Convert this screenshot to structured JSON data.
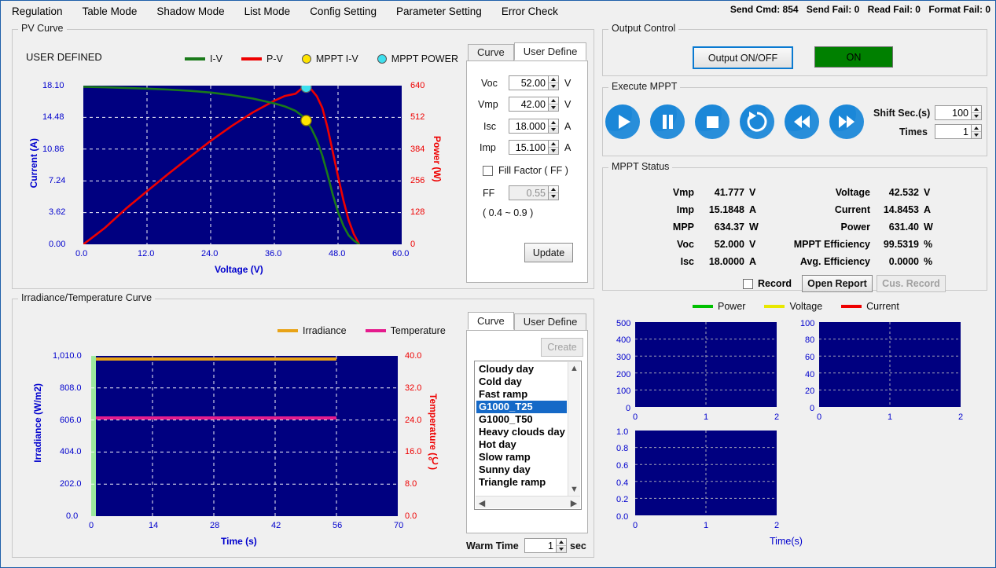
{
  "menu": {
    "items": [
      {
        "label": "Regulation"
      },
      {
        "label": "Table Mode"
      },
      {
        "label": "Shadow Mode"
      },
      {
        "label": "List Mode"
      },
      {
        "label": "Config Setting"
      },
      {
        "label": "Parameter Setting"
      },
      {
        "label": "Error Check"
      }
    ],
    "status": {
      "send_cmd": "Send Cmd: 854",
      "send_fail": "Send Fail: 0",
      "read_fail": "Read Fail: 0",
      "format_fail": "Format Fail: 0"
    }
  },
  "pv_curve": {
    "group_title": "PV Curve",
    "mode_label": "USER DEFINED",
    "legend": [
      {
        "name": "I-V",
        "kind": "line",
        "color": "#1a7a1a"
      },
      {
        "name": "P-V",
        "kind": "line",
        "color": "#ee0000"
      },
      {
        "name": "MPPT I-V",
        "kind": "dot",
        "color": "#ffe400"
      },
      {
        "name": "MPPT POWER",
        "kind": "dot",
        "color": "#3ee0ee"
      }
    ],
    "tabs": [
      {
        "label": "Curve",
        "active": false
      },
      {
        "label": "User Define",
        "active": true
      }
    ],
    "user_define": {
      "fields": [
        {
          "label": "Voc",
          "value": "52.00",
          "unit": "V"
        },
        {
          "label": "Vmp",
          "value": "42.00",
          "unit": "V"
        },
        {
          "label": "Isc",
          "value": "18.000",
          "unit": "A"
        },
        {
          "label": "Imp",
          "value": "15.100",
          "unit": "A"
        }
      ],
      "fill_factor_label": "Fill Factor ( FF )",
      "fill_factor_checked": false,
      "ff_label": "FF",
      "ff_value": "0.55",
      "ff_range": "( 0.4 ~ 0.9 )",
      "update_label": "Update"
    }
  },
  "irr_temp": {
    "group_title": "Irradiance/Temperature Curve",
    "legend": [
      {
        "name": "Irradiance",
        "color": "#e8a317"
      },
      {
        "name": "Temperature",
        "color": "#e51b8d"
      }
    ],
    "tabs": [
      {
        "label": "Curve",
        "active": true
      },
      {
        "label": "User Define",
        "active": false
      }
    ],
    "create_label": "Create",
    "list_items": [
      {
        "label": "Cloudy day",
        "selected": false
      },
      {
        "label": "Cold day",
        "selected": false
      },
      {
        "label": "Fast ramp",
        "selected": false
      },
      {
        "label": "G1000_T25",
        "selected": true
      },
      {
        "label": "G1000_T50",
        "selected": false
      },
      {
        "label": "Heavy clouds day",
        "selected": false
      },
      {
        "label": "Hot day",
        "selected": false
      },
      {
        "label": "Slow ramp",
        "selected": false
      },
      {
        "label": "Sunny day",
        "selected": false
      },
      {
        "label": "Triangle ramp",
        "selected": false
      }
    ],
    "warm_time_label": "Warm Time",
    "warm_time_value": "1",
    "warm_time_unit": "sec"
  },
  "output_control": {
    "group_title": "Output Control",
    "toggle_label": "Output ON/OFF",
    "state_label": "ON",
    "state_color": "#008000"
  },
  "execute_mppt": {
    "group_title": "Execute MPPT",
    "buttons": [
      {
        "name": "play"
      },
      {
        "name": "pause"
      },
      {
        "name": "stop"
      },
      {
        "name": "loop"
      },
      {
        "name": "rewind"
      },
      {
        "name": "forward"
      }
    ],
    "shift_label": "Shift Sec.(s)",
    "shift_value": "100",
    "times_label": "Times",
    "times_value": "1"
  },
  "mppt_status": {
    "group_title": "MPPT Status",
    "left": [
      {
        "label": "Vmp",
        "value": "41.777",
        "unit": "V"
      },
      {
        "label": "Imp",
        "value": "15.1848",
        "unit": "A"
      },
      {
        "label": "MPP",
        "value": "634.37",
        "unit": "W"
      },
      {
        "label": "Voc",
        "value": "52.000",
        "unit": "V"
      },
      {
        "label": "Isc",
        "value": "18.0000",
        "unit": "A"
      }
    ],
    "right": [
      {
        "label": "Voltage",
        "value": "42.532",
        "unit": "V"
      },
      {
        "label": "Current",
        "value": "14.8453",
        "unit": "A"
      },
      {
        "label": "Power",
        "value": "631.40",
        "unit": "W"
      },
      {
        "label": "MPPT Efficiency",
        "value": "99.5319",
        "unit": "%"
      },
      {
        "label": "Avg. Efficiency",
        "value": "0.0000",
        "unit": "%"
      }
    ],
    "record_label": "Record",
    "record_checked": false,
    "open_report_label": "Open Report",
    "cus_record_label": "Cus. Record"
  },
  "mini_charts": {
    "legend": [
      {
        "name": "Power",
        "color": "#00c000"
      },
      {
        "name": "Voltage",
        "color": "#e8e800"
      },
      {
        "name": "Current",
        "color": "#ee0000"
      }
    ],
    "xlabel": "Time(s)"
  },
  "chart_data": [
    {
      "type": "line",
      "name": "pv-curve",
      "title": "PV Curve",
      "xlabel": "Voltage (V)",
      "ylabel": "Current (A)",
      "y2label": "Power (W)",
      "xlim": [
        0.0,
        60.0
      ],
      "xticks": [
        "0.0",
        "12.0",
        "24.0",
        "36.0",
        "48.0",
        "60.0"
      ],
      "ylim": [
        0.0,
        18.1
      ],
      "yticks": [
        "0.00",
        "3.62",
        "7.24",
        "10.86",
        "14.48",
        "18.10"
      ],
      "y2lim": [
        0,
        640
      ],
      "y2ticks": [
        "0",
        "128",
        "256",
        "384",
        "512",
        "640"
      ],
      "grid": true,
      "series": [
        {
          "name": "I-V",
          "color": "#1a7a1a",
          "axis": "left",
          "x": [
            0,
            4,
            8,
            12,
            16,
            20,
            24,
            28,
            32,
            36,
            38,
            40,
            42,
            43,
            44,
            45,
            46,
            47,
            48,
            49,
            50,
            51,
            52
          ],
          "y": [
            18.05,
            18.0,
            17.93,
            17.85,
            17.74,
            17.6,
            17.4,
            17.1,
            16.7,
            16.15,
            15.8,
            15.3,
            14.6,
            14.0,
            13.1,
            11.8,
            10.0,
            7.9,
            5.6,
            3.5,
            1.9,
            0.8,
            0.0
          ]
        },
        {
          "name": "P-V",
          "color": "#ee0000",
          "axis": "right",
          "x": [
            0,
            4,
            8,
            12,
            16,
            20,
            24,
            28,
            32,
            36,
            38,
            40,
            41.5,
            42,
            43,
            44,
            45,
            46,
            47,
            48,
            49,
            50,
            51,
            52
          ],
          "y": [
            0,
            72,
            143,
            214,
            284,
            352,
            418,
            479,
            534,
            581,
            600,
            612,
            634,
            633,
            625,
            600,
            553,
            475,
            380,
            276,
            178,
            98,
            42,
            0
          ]
        }
      ],
      "markers": [
        {
          "name": "MPPT POWER",
          "color": "#3ee0ee",
          "x": 42.0,
          "y": 634.37,
          "axis": "right"
        },
        {
          "name": "MPPT I-V",
          "color": "#ffe400",
          "x": 42.0,
          "y": 15.1848,
          "axis": "left"
        }
      ]
    },
    {
      "type": "line",
      "name": "irradiance-temperature",
      "title": "Irradiance/Temperature Curve",
      "xlabel": "Time (s)",
      "ylabel": "Irradiance (W/m2)",
      "y2label": "Temperature (℃)",
      "xlim": [
        0,
        70
      ],
      "xticks": [
        "0",
        "14",
        "28",
        "42",
        "56",
        "70"
      ],
      "ylim": [
        0.0,
        1010.0
      ],
      "yticks": [
        "0.0",
        "202.0",
        "404.0",
        "606.0",
        "808.0",
        "1,010.0"
      ],
      "y2lim": [
        0.0,
        40.0
      ],
      "y2ticks": [
        "0.0",
        "8.0",
        "16.0",
        "24.0",
        "32.0",
        "40.0"
      ],
      "grid": true,
      "series": [
        {
          "name": "Irradiance",
          "color": "#e8a317",
          "axis": "left",
          "x": [
            0,
            56
          ],
          "y": [
            1000,
            1000
          ]
        },
        {
          "name": "Temperature",
          "color": "#e51b8d",
          "axis": "right",
          "x": [
            0,
            56
          ],
          "y": [
            25,
            25
          ]
        }
      ]
    },
    {
      "type": "line",
      "name": "power-mini",
      "xlabel": "",
      "ylabel": "",
      "xlim": [
        0,
        2
      ],
      "xticks": [
        "0",
        "1",
        "2"
      ],
      "ylim": [
        0,
        500
      ],
      "yticks": [
        "0",
        "100",
        "200",
        "300",
        "400",
        "500"
      ],
      "grid": true,
      "series": []
    },
    {
      "type": "line",
      "name": "voltage-mini",
      "xlabel": "",
      "ylabel": "",
      "xlim": [
        0,
        2
      ],
      "xticks": [
        "0",
        "1",
        "2"
      ],
      "ylim": [
        0,
        100
      ],
      "yticks": [
        "0",
        "20",
        "40",
        "60",
        "80",
        "100"
      ],
      "grid": true,
      "series": []
    },
    {
      "type": "line",
      "name": "current-mini",
      "xlabel": "Time(s)",
      "ylabel": "",
      "xlim": [
        0,
        2
      ],
      "xticks": [
        "0",
        "1",
        "2"
      ],
      "ylim": [
        0.0,
        1.0
      ],
      "yticks": [
        "0.0",
        "0.2",
        "0.4",
        "0.6",
        "0.8",
        "1.0"
      ],
      "grid": true,
      "series": []
    }
  ]
}
